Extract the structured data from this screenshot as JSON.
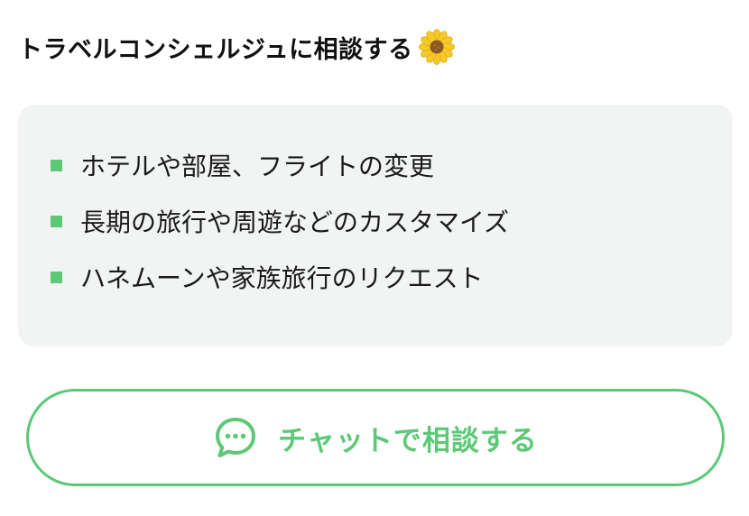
{
  "heading": {
    "title": "トラベルコンシェルジュに相談する",
    "emoji_icon": "sunflower-icon"
  },
  "features": {
    "items": [
      "ホテルや部屋、フライトの変更",
      "長期の旅行や周遊などのカスタマイズ",
      "ハネムーンや家族旅行のリクエスト"
    ]
  },
  "chat_button": {
    "label": "チャットで相談する",
    "icon": "chat-bubble-icon"
  },
  "colors": {
    "accent": "#5dc877",
    "box_background": "#f2f4f4",
    "text": "#111111"
  }
}
